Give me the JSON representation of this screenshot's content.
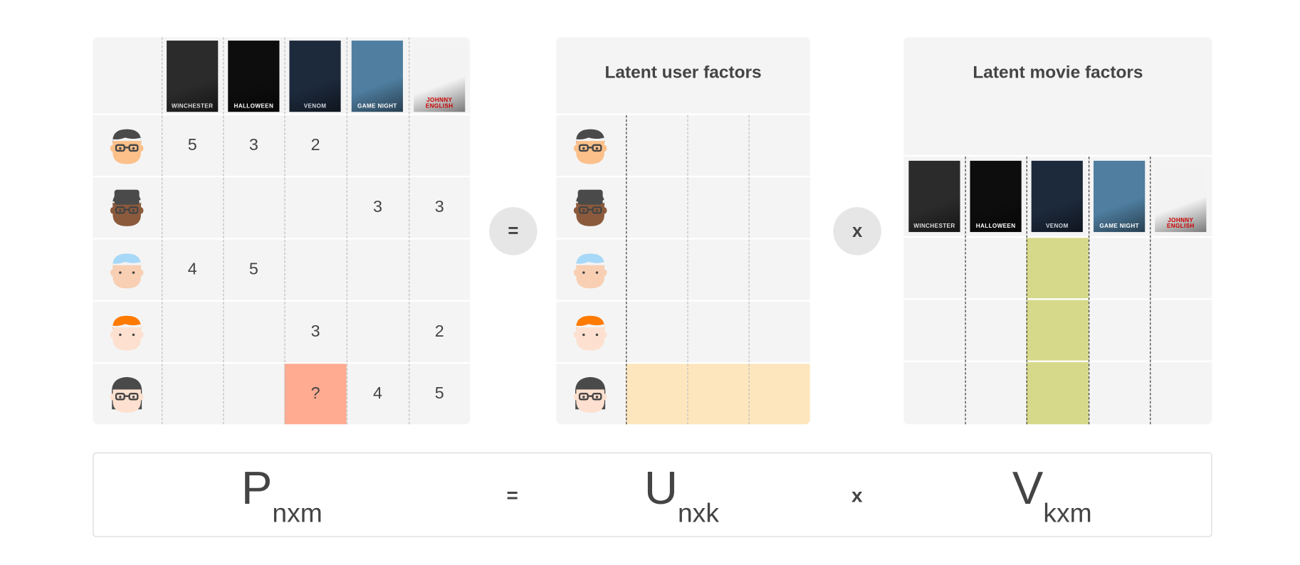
{
  "movies": [
    {
      "title": "WINCHESTER",
      "bg": "#2b2b2b",
      "fg": "#ddd"
    },
    {
      "title": "HALLOWEEN",
      "bg": "#0d0d0d",
      "fg": "#fff"
    },
    {
      "title": "VENOM",
      "bg": "#1d2a3c",
      "fg": "#cfd6e0"
    },
    {
      "title": "GAME NIGHT",
      "bg": "#4f7ea0",
      "fg": "#fff"
    },
    {
      "title": "JOHNNY ENGLISH",
      "bg": "#f3f3f3",
      "fg": "#c00"
    }
  ],
  "users": [
    {
      "avatar": "boy-glasses",
      "hair": "#4a4a4a",
      "skin": "#fcc08a",
      "glasses": true
    },
    {
      "avatar": "man-dark-skin-glasses",
      "hair": "#4a4a4a",
      "skin": "#8b5a3c",
      "glasses": true
    },
    {
      "avatar": "blue-hair",
      "hair": "#a8d8f8",
      "skin": "#f8cfb2",
      "glasses": false
    },
    {
      "avatar": "orange-hair",
      "hair": "#ff7a00",
      "skin": "#fde0cf",
      "glasses": false
    },
    {
      "avatar": "woman-glasses",
      "hair": "#4a4a4a",
      "skin": "#fde0cf",
      "glasses": true
    }
  ],
  "ratings": [
    [
      "5",
      "3",
      "2",
      "",
      ""
    ],
    [
      "",
      "",
      "",
      "3",
      "3"
    ],
    [
      "4",
      "5",
      "",
      "",
      ""
    ],
    [
      "",
      "",
      "3",
      "",
      "2"
    ],
    [
      "",
      "",
      "?",
      "4",
      "5"
    ]
  ],
  "unknown_cell": {
    "user": 4,
    "movie": 2,
    "color": "#ffab91"
  },
  "user_factors": {
    "title": "Latent user factors",
    "k": 3,
    "highlight_user": 4,
    "color": "#fde6bd"
  },
  "movie_factors": {
    "title": "Latent movie factors",
    "k": 3,
    "highlight_movie": 2,
    "color": "#d6d98a"
  },
  "operators": {
    "equals": "=",
    "times": "x"
  },
  "formula": {
    "p": "P",
    "p_sub": "nxm",
    "equals": "=",
    "u": "U",
    "u_sub": "nxk",
    "times": "x",
    "v": "V",
    "v_sub": "kxm"
  }
}
